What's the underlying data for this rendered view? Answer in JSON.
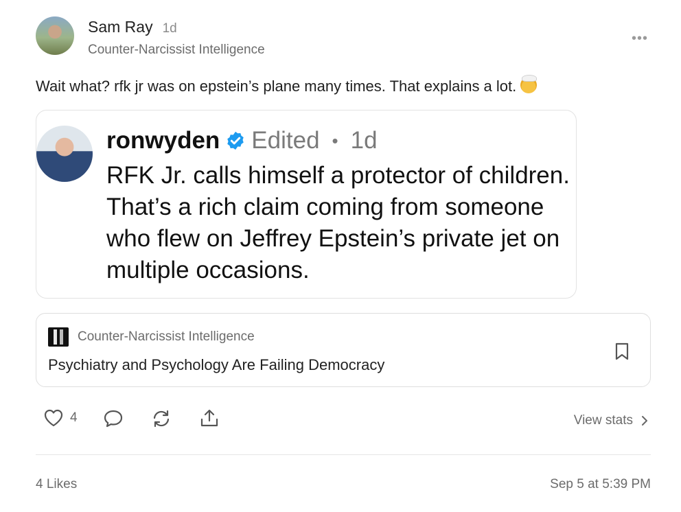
{
  "post": {
    "author": "Sam Ray",
    "age": "1d",
    "publication": "Counter-Narcissist Intelligence",
    "more_icon": "ellipsis-icon",
    "text": "Wait what? rfk jr was on epstein’s plane many times. That explains a lot.",
    "emoji": "exploding-head-emoji"
  },
  "embed": {
    "handle": "ronwyden",
    "edited": "Edited",
    "dot": "•",
    "age": "1d",
    "body": "RFK Jr. calls himself a protector of children. That’s a rich claim coming from someone who flew on Jeffrey Epstein’s private jet on multiple occasions.",
    "verified_color": "#1d9bf0"
  },
  "pub_card": {
    "name": "Counter-Narcissist Intelligence",
    "title": "Psychiatry and Psychology Are Failing Democracy",
    "bookmark_icon": "bookmark-icon"
  },
  "actions": {
    "like_count": "4",
    "view_stats": "View stats",
    "icons": [
      "heart-icon",
      "comment-icon",
      "restack-icon",
      "share-icon",
      "chevron-right-icon"
    ]
  },
  "footer": {
    "likes": "4 Likes",
    "timestamp": "Sep 5 at 5:39 PM"
  }
}
